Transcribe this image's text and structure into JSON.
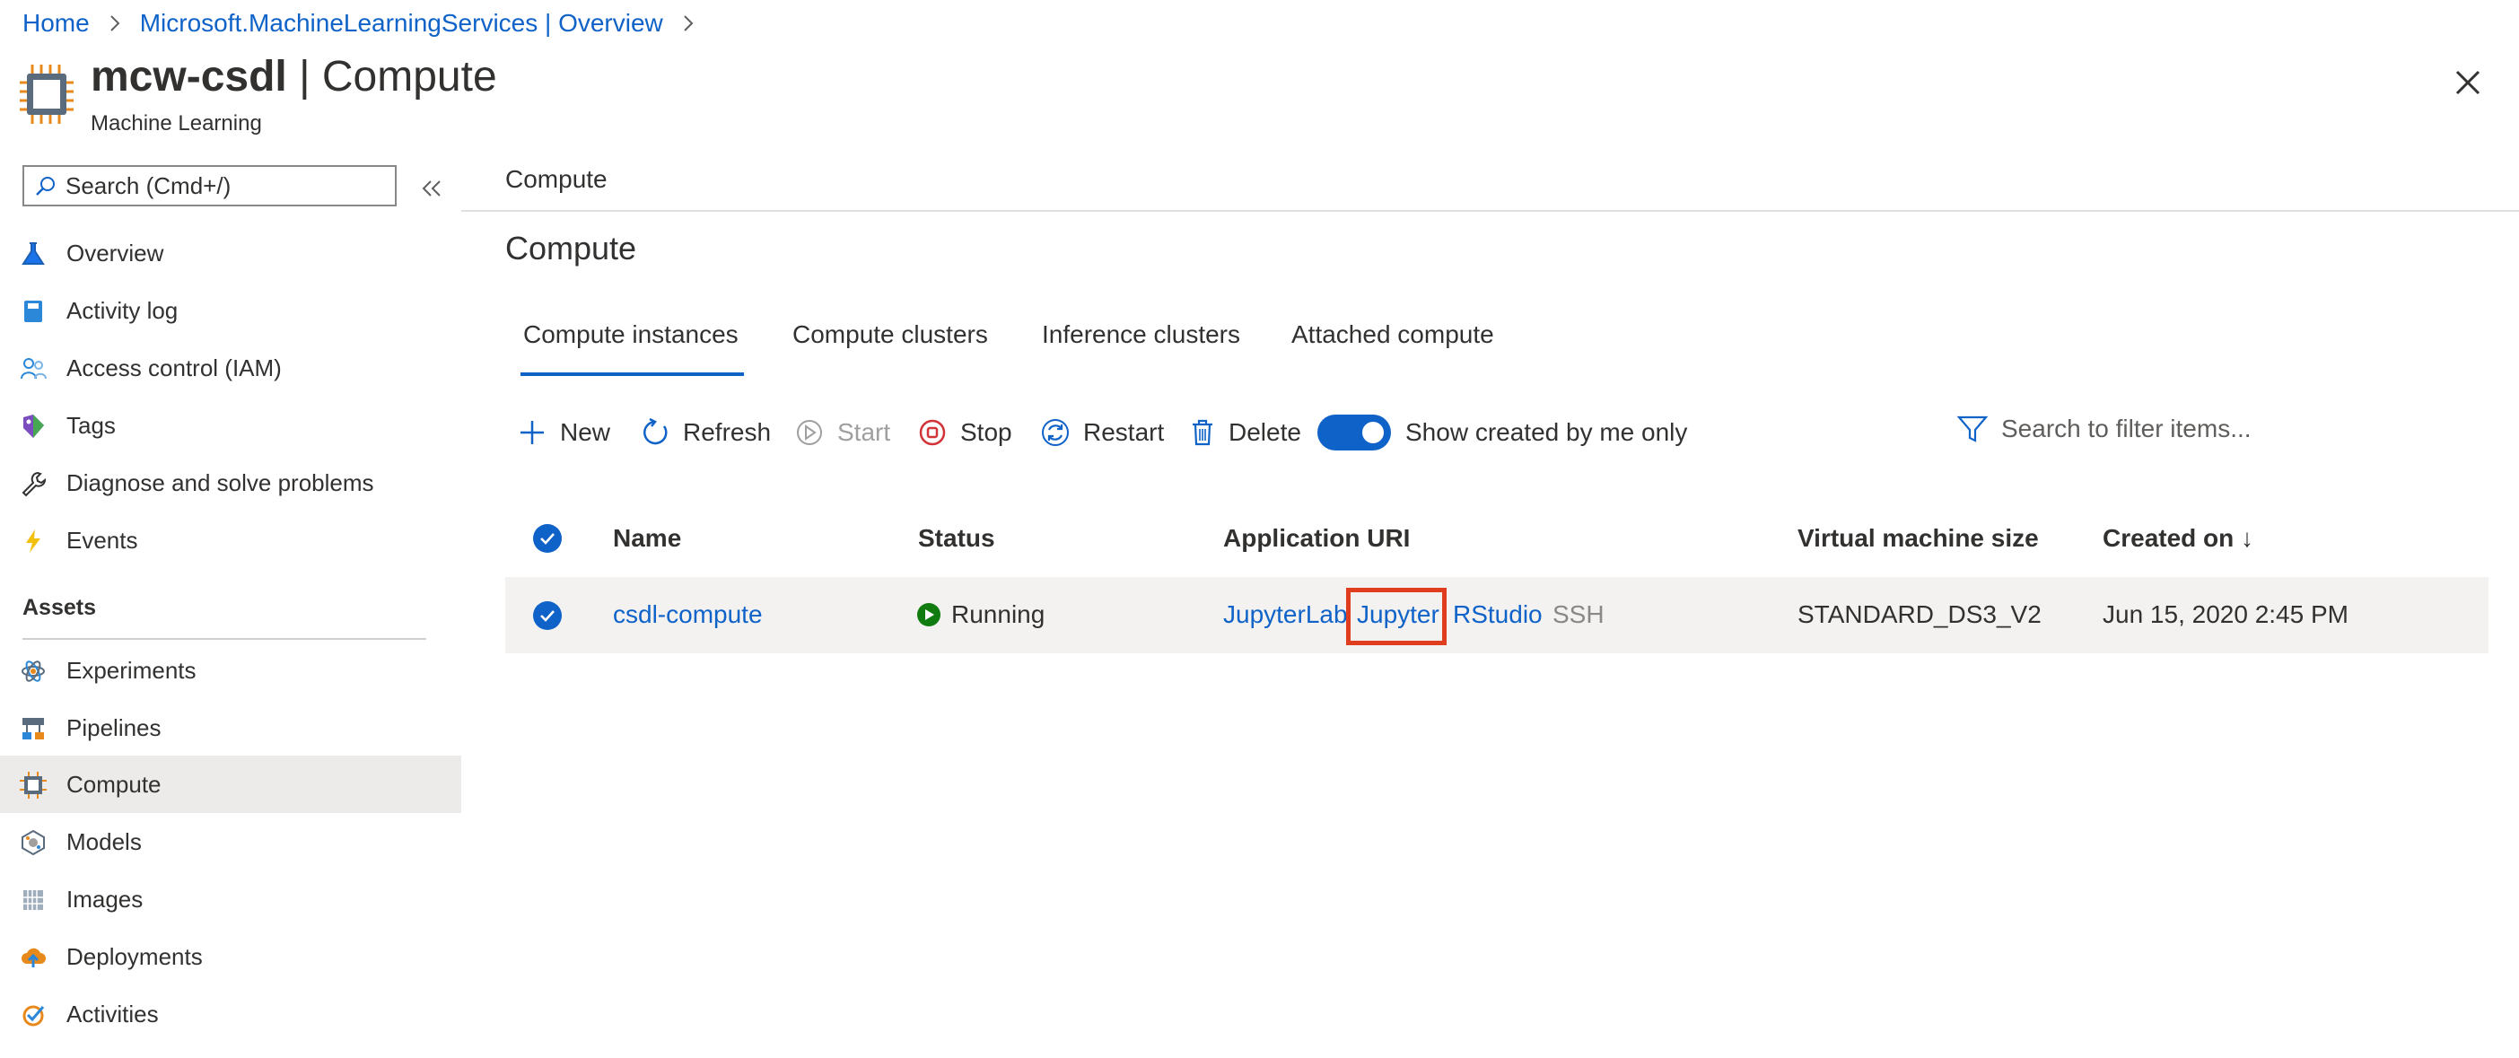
{
  "breadcrumb": {
    "home": "Home",
    "parent": "Microsoft.MachineLearningServices | Overview"
  },
  "header": {
    "resource_name": "mcw-csdl",
    "separator": " | ",
    "page_name": "Compute",
    "subtitle": "Machine Learning"
  },
  "sidebar": {
    "search_placeholder": "Search (Cmd+/)",
    "items": [
      {
        "label": "Overview",
        "icon": "flask-icon"
      },
      {
        "label": "Activity log",
        "icon": "log-book-icon"
      },
      {
        "label": "Access control (IAM)",
        "icon": "people-icon"
      },
      {
        "label": "Tags",
        "icon": "tag-icon"
      },
      {
        "label": "Diagnose and solve problems",
        "icon": "wrench-icon"
      },
      {
        "label": "Events",
        "icon": "lightning-icon"
      }
    ],
    "assets_heading": "Assets",
    "assets": [
      {
        "label": "Experiments",
        "icon": "atom-icon"
      },
      {
        "label": "Pipelines",
        "icon": "pipeline-icon"
      },
      {
        "label": "Compute",
        "icon": "chip-icon",
        "selected": true
      },
      {
        "label": "Models",
        "icon": "model-icon"
      },
      {
        "label": "Images",
        "icon": "image-stack-icon"
      },
      {
        "label": "Deployments",
        "icon": "cloud-upload-icon"
      },
      {
        "label": "Activities",
        "icon": "check-badge-icon"
      }
    ]
  },
  "main": {
    "header": "Compute",
    "title": "Compute",
    "tabs": [
      {
        "label": "Compute instances",
        "active": true
      },
      {
        "label": "Compute clusters"
      },
      {
        "label": "Inference clusters"
      },
      {
        "label": "Attached compute"
      }
    ],
    "toolbar": {
      "new": "New",
      "refresh": "Refresh",
      "start": "Start",
      "stop": "Stop",
      "restart": "Restart",
      "delete": "Delete",
      "toggle_label": "Show created by me only",
      "toggle_on": true,
      "filter_placeholder": "Search to filter items..."
    },
    "table": {
      "columns": [
        "Name",
        "Status",
        "Application URI",
        "Virtual machine size",
        "Created on ↓"
      ],
      "rows": [
        {
          "selected": true,
          "name": "csdl-compute",
          "status": "Running",
          "uris": [
            "JupyterLab",
            "Jupyter",
            "RStudio",
            "SSH"
          ],
          "vm_size": "STANDARD_DS3_V2",
          "created_on": "Jun 15, 2020 2:45 PM"
        }
      ]
    }
  },
  "colors": {
    "accent": "#0f62c8",
    "running": "#107c10",
    "highlight": "#e03c1e",
    "selected_nav": "#edebe9"
  }
}
